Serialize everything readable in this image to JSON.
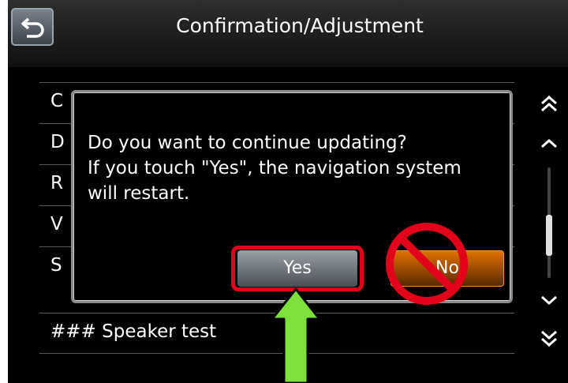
{
  "header": {
    "title": "Confirmation/Adjustment",
    "back_icon": "back-arrow-icon"
  },
  "list": {
    "rows": [
      {
        "label": "C"
      },
      {
        "label": "D"
      },
      {
        "label": "R"
      },
      {
        "label": "V"
      },
      {
        "label": "S"
      },
      {
        "label": "### Speaker test"
      }
    ]
  },
  "dialog": {
    "lines": [
      "Do you want to continue updating?",
      "If you touch \"Yes\", the navigation system",
      "will restart."
    ],
    "yes_label": "Yes",
    "no_label": "No"
  },
  "scrollbar": {
    "icons": [
      "double-chevron-up-icon",
      "chevron-up-icon",
      "chevron-down-icon",
      "double-chevron-down-icon"
    ]
  },
  "annotations": {
    "highlight_color": "#e3001b",
    "arrow_color": "#7ee03a",
    "prohibited_icon": "prohibition-icon"
  }
}
